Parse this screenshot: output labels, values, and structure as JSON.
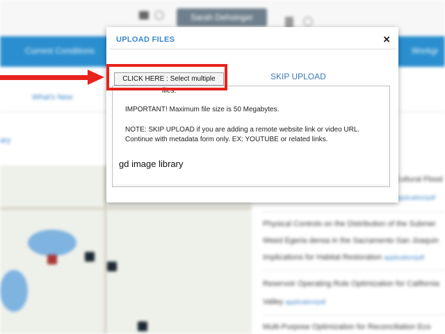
{
  "header": {
    "user_button_label": "Sarah Dehsinger"
  },
  "nav": {
    "items": [
      "Current Conditions"
    ],
    "right_label": "Workgr"
  },
  "subnav": {
    "items": [
      "What's New"
    ]
  },
  "side_label": "ary",
  "list": {
    "items": [
      {
        "title": "Cultural Flood",
        "link": "application/pdf"
      },
      {
        "title": "Physical Controls on the Distribution of the Submer",
        "link": ""
      },
      {
        "title": "Weed Egeria densa in the Sacramento San Joaquin",
        "link": ""
      },
      {
        "title": "Implications for Habitat Restoration",
        "link": "application/pdf"
      },
      {
        "title": "Reservoir Operating Rule Optimization for California",
        "link": ""
      },
      {
        "title": "Valley",
        "link": "application/pdf"
      },
      {
        "title": "Multi-Purpose Optimization for Reconciliation Eco",
        "link": ""
      }
    ]
  },
  "modal": {
    "title": "UPLOAD FILES",
    "close_symbol": "×",
    "select_button_label": "CLICK HERE : Select multiple files.",
    "skip_label": "SKIP UPLOAD",
    "important_text": "IMPORTANT! Maximum file size is 50 Megabytes.",
    "note_line1": "NOTE: SKIP UPLOAD if you are adding a remote website link or video URL.",
    "note_line2": "Continue with metadata form only. EX: YOUTUBE or related links.",
    "library_label": "gd image library"
  },
  "icons": [
    "print-icon",
    "help-icon",
    "thumbs-up-icon",
    "refresh-icon",
    "close-icon",
    "arrow-icon"
  ],
  "colors": {
    "accent": "#2b8fcf",
    "link": "#3a87c8",
    "highlight": "#e8221c"
  }
}
